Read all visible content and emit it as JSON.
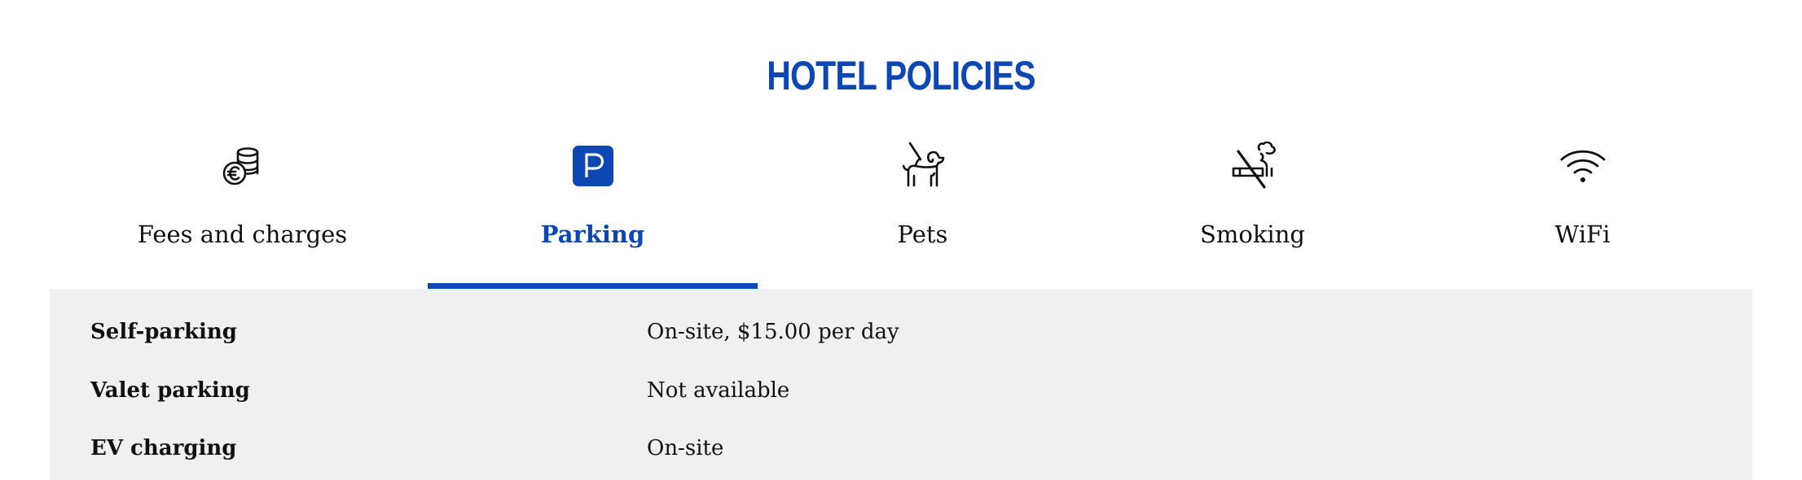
{
  "title": "HOTEL POLICIES",
  "accent_color": "#0d47b3",
  "tabs": [
    {
      "label": "Fees and charges",
      "icon": "coins-euro-icon",
      "active": false
    },
    {
      "label": "Parking",
      "icon": "parking-icon",
      "active": true
    },
    {
      "label": "Pets",
      "icon": "dog-leash-icon",
      "active": false
    },
    {
      "label": "Smoking",
      "icon": "no-smoking-icon",
      "active": false
    },
    {
      "label": "WiFi",
      "icon": "wifi-icon",
      "active": false
    }
  ],
  "policies": [
    {
      "name": "Self-parking",
      "value": "On-site, $15.00 per day"
    },
    {
      "name": "Valet parking",
      "value": "Not available"
    },
    {
      "name": "EV charging",
      "value": "On-site"
    }
  ]
}
